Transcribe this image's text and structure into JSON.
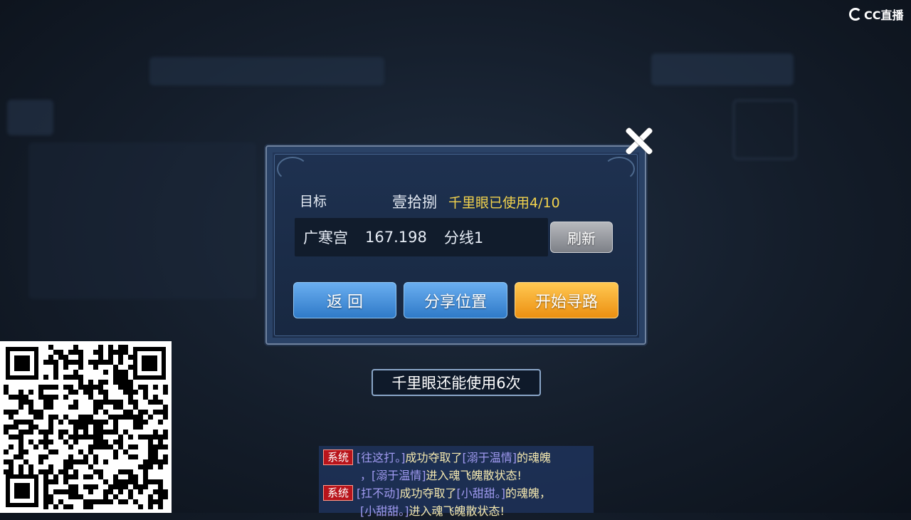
{
  "overlay": {
    "brand": "CC直播"
  },
  "dialog": {
    "target_label": "目标",
    "target_name": "壹拾捌",
    "usage": "千里眼已使用4/10",
    "location": "广寒宫",
    "coords": "167.198",
    "server_line": "分线1",
    "refresh_label": "刷新",
    "back_label": "返 回",
    "share_label": "分享位置",
    "pathfind_label": "开始寻路"
  },
  "notice": {
    "text": "千里眼还能使用6次"
  },
  "chat": {
    "messages": [
      {
        "tag": "系统",
        "p1": "[往这打。]",
        "t1": "成功夺取了",
        "p2": "[溺于温情]",
        "t2": "的魂魄",
        "p3": "，[溺于温情]",
        "t3": "进入魂飞魄散状态!"
      },
      {
        "tag": "系统",
        "p1": "[扛不动]",
        "t1": "成功夺取了",
        "p2": "[小甜甜。]",
        "t2": "的魂魄，",
        "p3": "[小甜甜。]",
        "t3": "进入魂飞魄散状态!"
      }
    ]
  },
  "colors": {
    "accent_yellow": "#f3d34d",
    "button_blue": "#2f7ac8",
    "button_orange": "#ec9011",
    "system_red": "#b8141b"
  }
}
